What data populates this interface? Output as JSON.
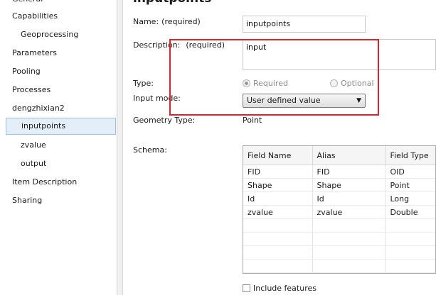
{
  "nav": {
    "items": [
      {
        "label": "General",
        "level": 0
      },
      {
        "label": "Capabilities",
        "level": 0
      },
      {
        "label": "Geoprocessing",
        "level": 1
      },
      {
        "label": "Parameters",
        "level": 0
      },
      {
        "label": "Pooling",
        "level": 0
      },
      {
        "label": "Processes",
        "level": 0
      },
      {
        "label": "dengzhixian2",
        "level": 0
      },
      {
        "label": "inputpoints",
        "level": 1,
        "selected": true
      },
      {
        "label": "zvalue",
        "level": 1
      },
      {
        "label": "output",
        "level": 1
      },
      {
        "label": "Item Description",
        "level": 0
      },
      {
        "label": "Sharing",
        "level": 0
      }
    ]
  },
  "panel": {
    "heading": "inputpoints",
    "name_label": "Name:",
    "name_required": "(required)",
    "name_value": "inputpoints",
    "description_label": "Description:",
    "description_required": "(required)",
    "description_value": "input",
    "type_label": "Type:",
    "type_required": "Required",
    "type_optional": "Optional",
    "input_mode_label": "Input mode:",
    "input_mode_value": "User defined value",
    "geometry_type_label": "Geometry Type:",
    "geometry_type_value": "Point",
    "schema_label": "Schema:",
    "include_features_label": "Include features",
    "highlight_color": "#e0202a"
  },
  "schema": {
    "columns": [
      "Field Name",
      "Alias",
      "Field Type"
    ],
    "rows": [
      [
        "FID",
        "FID",
        "OID"
      ],
      [
        "Shape",
        "Shape",
        "Point"
      ],
      [
        "Id",
        "Id",
        "Long"
      ],
      [
        "zvalue",
        "zvalue",
        "Double"
      ]
    ]
  }
}
